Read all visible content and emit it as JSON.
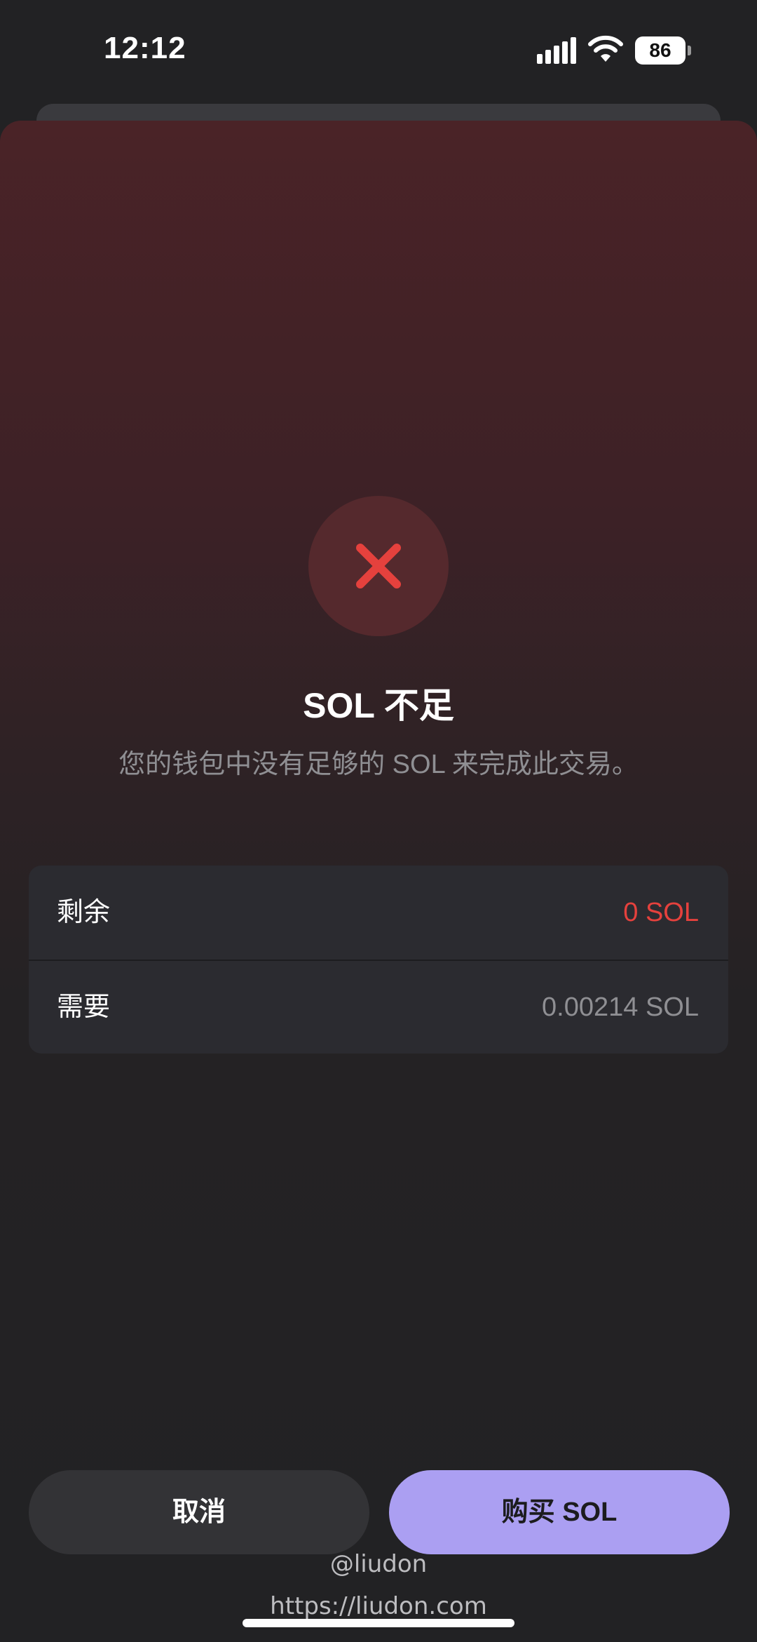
{
  "status_bar": {
    "time": "12:12",
    "battery_level": "86",
    "icons": [
      "signal-icon",
      "wifi-icon",
      "battery-icon"
    ]
  },
  "error_icon": "close-x-icon",
  "title": "SOL 不足",
  "subtitle": "您的钱包中没有足够的 SOL 来完成此交易。",
  "details": [
    {
      "label": "剩余",
      "value": "0 SOL",
      "value_color": "#e5413d"
    },
    {
      "label": "需要",
      "value": "0.00214 SOL",
      "value_color": "#8f8f93"
    }
  ],
  "buttons": {
    "cancel_label": "取消",
    "buy_label": "购买 SOL"
  },
  "watermark": {
    "handle": "@liudon",
    "url": "https://liudon.com"
  },
  "colors": {
    "accent": "#ab9ff2",
    "error": "#e5413d",
    "background": "#222224"
  }
}
